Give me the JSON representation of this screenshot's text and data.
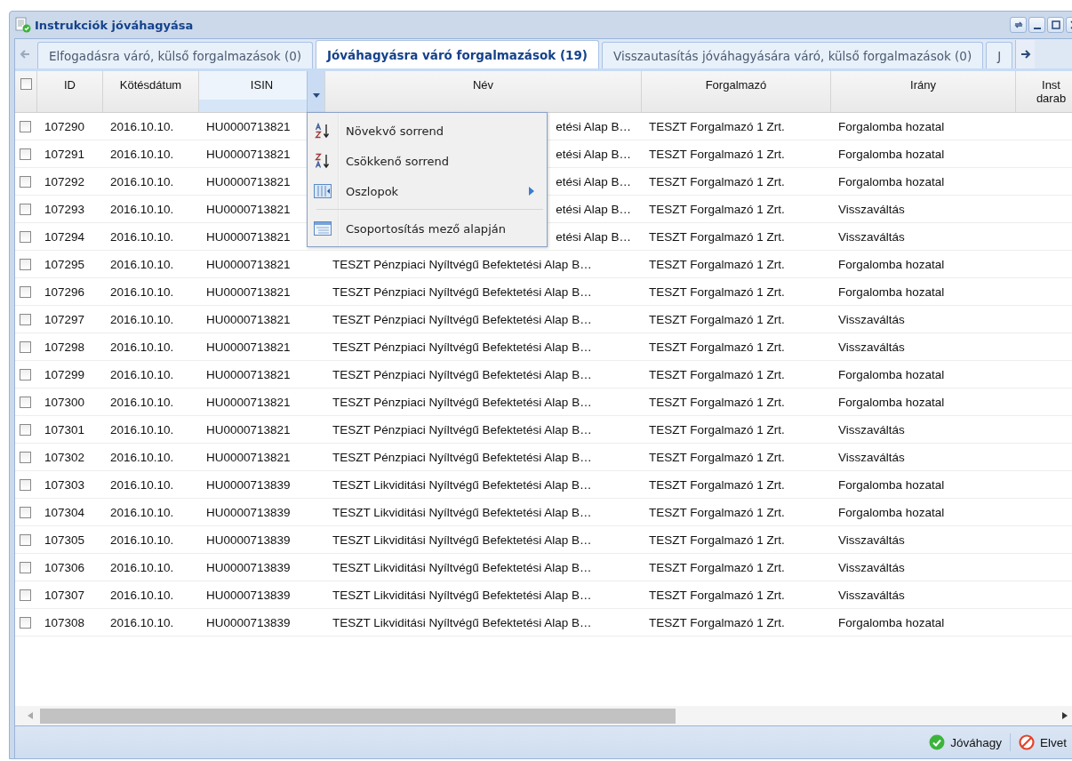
{
  "window": {
    "title": "Instrukciók jóváhagyása"
  },
  "tabs": [
    {
      "label": "Elfogadásra váró, külső forgalmazások (0)",
      "selected": false
    },
    {
      "label": "Jóváhagyásra váró forgalmazások (19)",
      "selected": true
    },
    {
      "label": "Visszautasítás jóváhagyására váró, külső forgalmazások (0)",
      "selected": false
    },
    {
      "label": "J",
      "selected": false
    }
  ],
  "table": {
    "select_all": {
      "checked": false
    },
    "columns": [
      {
        "label": "ID",
        "active": false
      },
      {
        "label": "Kötésdátum",
        "active": false
      },
      {
        "label": "ISIN",
        "active": true
      },
      {
        "label": "Név",
        "active": false
      },
      {
        "label": "Forgalmazó",
        "active": false
      },
      {
        "label": "Irány",
        "active": false
      },
      {
        "label": "Inst darab",
        "active": false
      }
    ],
    "rows": [
      {
        "checked": false,
        "kind": "covered",
        "cells": [
          "107290",
          "2016.10.10.",
          "HU0000713821",
          "etési Alap B…",
          "TESZT Forgalmazó 1 Zrt.",
          "Forgalomba hozatal"
        ]
      },
      {
        "checked": false,
        "kind": "covered",
        "cells": [
          "107291",
          "2016.10.10.",
          "HU0000713821",
          "etési Alap B…",
          "TESZT Forgalmazó 1 Zrt.",
          "Forgalomba hozatal"
        ]
      },
      {
        "checked": false,
        "kind": "covered",
        "cells": [
          "107292",
          "2016.10.10.",
          "HU0000713821",
          "etési Alap B…",
          "TESZT Forgalmazó 1 Zrt.",
          "Forgalomba hozatal"
        ]
      },
      {
        "checked": false,
        "kind": "covered",
        "cells": [
          "107293",
          "2016.10.10.",
          "HU0000713821",
          "etési Alap B…",
          "TESZT Forgalmazó 1 Zrt.",
          "Visszaváltás"
        ]
      },
      {
        "checked": false,
        "kind": "covered",
        "cells": [
          "107294",
          "2016.10.10.",
          "HU0000713821",
          "etési Alap B…",
          "TESZT Forgalmazó 1 Zrt.",
          "Visszaváltás"
        ]
      },
      {
        "checked": false,
        "kind": "plain",
        "cells": [
          "107295",
          "2016.10.10.",
          "HU0000713821",
          "TESZT Pénzpiaci Nyíltvégű Befektetési Alap B…",
          "TESZT Forgalmazó 1 Zrt.",
          "Forgalomba hozatal"
        ]
      },
      {
        "checked": false,
        "kind": "plain",
        "cells": [
          "107296",
          "2016.10.10.",
          "HU0000713821",
          "TESZT Pénzpiaci Nyíltvégű Befektetési Alap B…",
          "TESZT Forgalmazó 1 Zrt.",
          "Forgalomba hozatal"
        ]
      },
      {
        "checked": false,
        "kind": "plain",
        "cells": [
          "107297",
          "2016.10.10.",
          "HU0000713821",
          "TESZT Pénzpiaci Nyíltvégű Befektetési Alap B…",
          "TESZT Forgalmazó 1 Zrt.",
          "Visszaváltás"
        ]
      },
      {
        "checked": false,
        "kind": "plain",
        "cells": [
          "107298",
          "2016.10.10.",
          "HU0000713821",
          "TESZT Pénzpiaci Nyíltvégű Befektetési Alap B…",
          "TESZT Forgalmazó 1 Zrt.",
          "Visszaváltás"
        ]
      },
      {
        "checked": false,
        "kind": "plain",
        "cells": [
          "107299",
          "2016.10.10.",
          "HU0000713821",
          "TESZT Pénzpiaci Nyíltvégű Befektetési Alap B…",
          "TESZT Forgalmazó 1 Zrt.",
          "Forgalomba hozatal"
        ]
      },
      {
        "checked": false,
        "kind": "plain",
        "cells": [
          "107300",
          "2016.10.10.",
          "HU0000713821",
          "TESZT Pénzpiaci Nyíltvégű Befektetési Alap B…",
          "TESZT Forgalmazó 1 Zrt.",
          "Forgalomba hozatal"
        ]
      },
      {
        "checked": false,
        "kind": "plain",
        "cells": [
          "107301",
          "2016.10.10.",
          "HU0000713821",
          "TESZT Pénzpiaci Nyíltvégű Befektetési Alap B…",
          "TESZT Forgalmazó 1 Zrt.",
          "Visszaváltás"
        ]
      },
      {
        "checked": false,
        "kind": "plain",
        "cells": [
          "107302",
          "2016.10.10.",
          "HU0000713821",
          "TESZT Pénzpiaci Nyíltvégű Befektetési Alap B…",
          "TESZT Forgalmazó 1 Zrt.",
          "Visszaváltás"
        ]
      },
      {
        "checked": false,
        "kind": "plain",
        "cells": [
          "107303",
          "2016.10.10.",
          "HU0000713839",
          "TESZT Likviditási Nyíltvégű Befektetési Alap B…",
          "TESZT Forgalmazó 1 Zrt.",
          "Forgalomba hozatal"
        ]
      },
      {
        "checked": false,
        "kind": "plain",
        "cells": [
          "107304",
          "2016.10.10.",
          "HU0000713839",
          "TESZT Likviditási Nyíltvégű Befektetési Alap B…",
          "TESZT Forgalmazó 1 Zrt.",
          "Forgalomba hozatal"
        ]
      },
      {
        "checked": false,
        "kind": "plain",
        "cells": [
          "107305",
          "2016.10.10.",
          "HU0000713839",
          "TESZT Likviditási Nyíltvégű Befektetési Alap B…",
          "TESZT Forgalmazó 1 Zrt.",
          "Visszaváltás"
        ]
      },
      {
        "checked": false,
        "kind": "plain",
        "cells": [
          "107306",
          "2016.10.10.",
          "HU0000713839",
          "TESZT Likviditási Nyíltvégű Befektetési Alap B…",
          "TESZT Forgalmazó 1 Zrt.",
          "Visszaváltás"
        ]
      },
      {
        "checked": false,
        "kind": "plain",
        "cells": [
          "107307",
          "2016.10.10.",
          "HU0000713839",
          "TESZT Likviditási Nyíltvégű Befektetési Alap B…",
          "TESZT Forgalmazó 1 Zrt.",
          "Visszaváltás"
        ]
      },
      {
        "checked": false,
        "kind": "plain",
        "cells": [
          "107308",
          "2016.10.10.",
          "HU0000713839",
          "TESZT Likviditási Nyíltvégű Befektetési Alap B…",
          "TESZT Forgalmazó 1 Zrt.",
          "Forgalomba hozatal"
        ]
      }
    ]
  },
  "column_menu": {
    "items": [
      {
        "kind": "sort_asc",
        "label": "Növekvő sorrend"
      },
      {
        "kind": "sort_desc",
        "label": "Csökkenő sorrend"
      },
      {
        "kind": "columns",
        "label": "Oszlopok"
      },
      {
        "kind": "separator"
      },
      {
        "kind": "group",
        "label": "Csoportosítás mező alapján"
      }
    ]
  },
  "footer": {
    "buttons": [
      {
        "kind": "approve",
        "label": "Jóváhagy"
      },
      {
        "kind": "reject",
        "label": "Elvet"
      }
    ]
  }
}
